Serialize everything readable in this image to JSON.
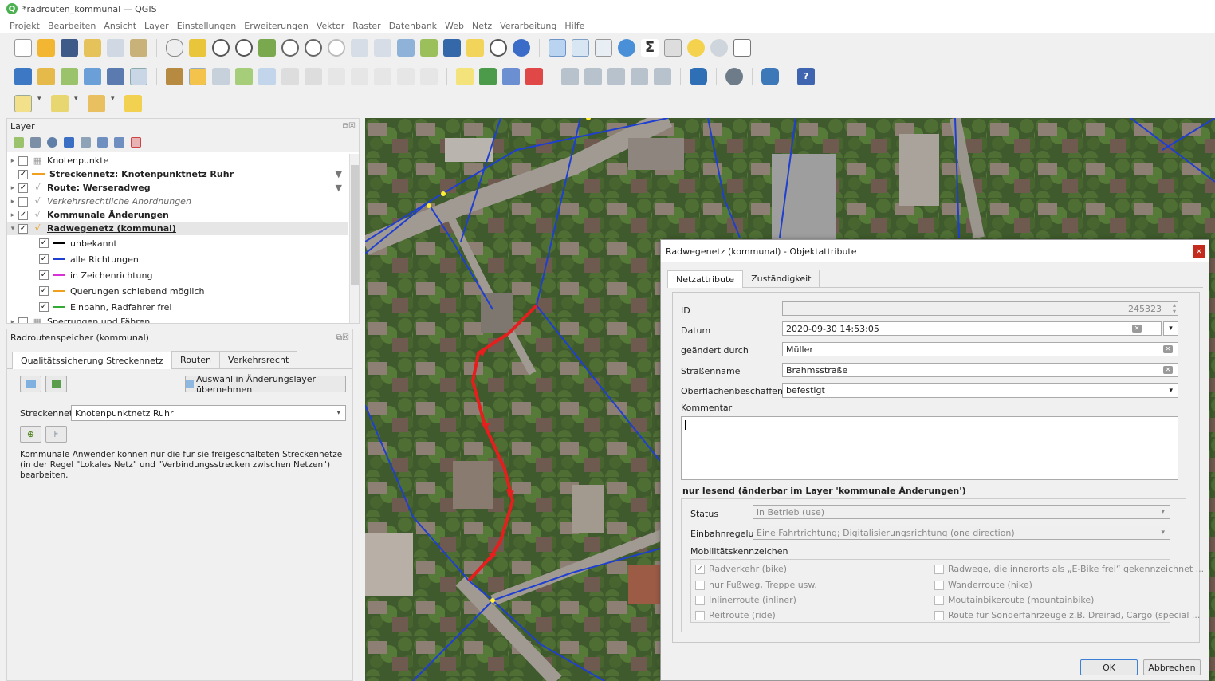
{
  "window": {
    "title": "*radrouten_kommunal — QGIS"
  },
  "menu": [
    "Projekt",
    "Bearbeiten",
    "Ansicht",
    "Layer",
    "Einstellungen",
    "Erweiterungen",
    "Vektor",
    "Raster",
    "Datenbank",
    "Web",
    "Netz",
    "Verarbeitung",
    "Hilfe"
  ],
  "layer_panel": {
    "title": "Layer",
    "items": [
      {
        "label": "Knotenpunkte",
        "bold": false,
        "italic": false,
        "checked": false,
        "icon": "group-icon"
      },
      {
        "label": "Streckennetz: Knotenpunktnetz Ruhr",
        "bold": true,
        "italic": false,
        "checked": true,
        "icon": "line-swatch-orange"
      },
      {
        "label": "Route: Werseradweg",
        "bold": true,
        "italic": false,
        "checked": true,
        "icon": "line-layer-icon"
      },
      {
        "label": "Verkehrsrechtliche Anordnungen",
        "bold": false,
        "italic": true,
        "checked": false,
        "icon": "line-layer-icon"
      },
      {
        "label": "Kommunale Änderungen",
        "bold": true,
        "italic": false,
        "checked": true,
        "icon": "line-layer-icon"
      },
      {
        "label": "Radwegenetz (kommunal)",
        "bold": true,
        "italic": false,
        "checked": true,
        "icon": "line-layer-icon"
      },
      {
        "label": "unbekannt",
        "checked": true,
        "color": "#000000"
      },
      {
        "label": "alle Richtungen",
        "checked": true,
        "color": "#1f3fd0"
      },
      {
        "label": "in Zeichenrichtung",
        "checked": true,
        "color": "#d633d6"
      },
      {
        "label": "Querungen schiebend möglich",
        "checked": true,
        "color": "#f0a020"
      },
      {
        "label": "Einbahn, Radfahrer frei",
        "checked": true,
        "color": "#33aa33"
      },
      {
        "label": "Sperrungen und Fähren",
        "checked": false,
        "icon": "group-icon"
      }
    ]
  },
  "rr_panel": {
    "title": "Radroutenspeicher (kommunal)",
    "tabs": [
      "Qualitätssicherung Streckennetz",
      "Routen",
      "Verkehrsrecht"
    ],
    "apply_button": "Auswahl in Änderungslayer übernehmen",
    "streckennetz_label": "Streckennetz",
    "streckennetz_value": "Knotenpunktnetz Ruhr",
    "info_text": "Kommunale Anwender können nur die für sie freigeschalteten Streckennetze (in der Regel \"Lokales Netz\" und \"Verbindungsstrecken zwischen Netzen\") bearbeiten."
  },
  "dialog": {
    "title": "Radwegenetz (kommunal) - Objektattribute",
    "tabs": [
      "Netzattribute",
      "Zuständigkeit"
    ],
    "fields": {
      "id_label": "ID",
      "id_value": "245323",
      "datum_label": "Datum",
      "datum_value": "2020-09-30 14:53:05",
      "geaendert_label": "geändert durch",
      "geaendert_value": "Müller",
      "strasse_label": "Straßenname",
      "strasse_value": "Brahmsstraße",
      "oberflaeche_label": "Oberflächenbeschaffenheit",
      "oberflaeche_value": "befestigt",
      "kommentar_label": "Kommentar"
    },
    "readonly_group": {
      "title": "nur lesend (änderbar im Layer 'kommunale Änderungen')",
      "status_label": "Status",
      "status_value": "in Betrieb (use)",
      "einbahn_label": "Einbahnregelung",
      "einbahn_value": "Eine Fahrtrichtung; Digitalisierungsrichtung (one direction)",
      "mobil_label": "Mobilitätskennzeichen",
      "checks_left": [
        {
          "label": "Radverkehr (bike)",
          "checked": true
        },
        {
          "label": "nur Fußweg, Treppe usw.",
          "checked": false
        },
        {
          "label": "Inlinerroute (inliner)",
          "checked": false
        },
        {
          "label": "Reitroute (ride)",
          "checked": false
        }
      ],
      "checks_right": [
        {
          "label": "Radwege, die innerorts als „E-Bike frei“ gekennzeichnet ...",
          "checked": false
        },
        {
          "label": "Wanderroute (hike)",
          "checked": false
        },
        {
          "label": "Moutainbikeroute (mountainbike)",
          "checked": false
        },
        {
          "label": "Route für Sonderfahrzeuge z.B. Dreirad, Cargo (special ...",
          "checked": false
        }
      ]
    },
    "ok_button": "OK",
    "cancel_button": "Abbrechen"
  }
}
